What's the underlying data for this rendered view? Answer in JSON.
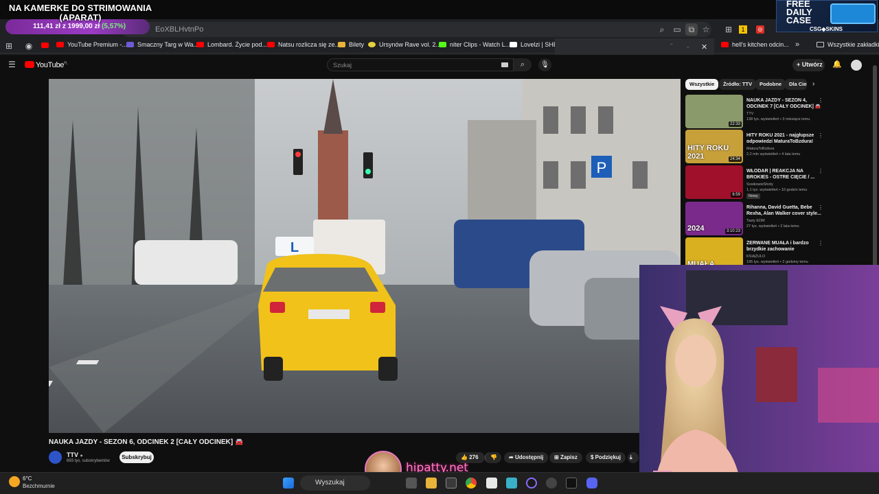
{
  "overlay": {
    "title": "NA KAMERKE DO STRIMOWANIA (APARAT)",
    "goal_text": "111,41 zł z 1999,00 zł",
    "goal_pct": "(5,57%)",
    "goal_fraction": 0.0557
  },
  "promo": {
    "line1": "FREE",
    "line2": "DAILY",
    "line3": "CASE",
    "brand": "CSG◆SKINS"
  },
  "browser": {
    "url": "EoXBLHvtnPo",
    "bookmarks": [
      "YouTube Premium -...",
      "Smaczny Targ w Wa...",
      "Lombard. Życie pod...",
      "Natsu rozlicza się ze...",
      "Bilety",
      "Ursynów Rave vol. 2...",
      "niter Clips - Watch L...",
      "Lovelzi | SHEIN",
      "hell's kitchen odcin...",
      "Wszystkie zakładki"
    ]
  },
  "youtube": {
    "logo": "YouTube",
    "region": "PL",
    "search_placeholder": "Szukaj",
    "create_label": "Utwórz"
  },
  "video": {
    "title": "NAUKA JAZDY - SEZON 6, ODCINEK 2 [CAŁY ODCINEK] 🚘",
    "channel": "TTV",
    "subscribers": "693 tys. subskrybentów",
    "subscribe_label": "Subskrybuj",
    "likes": "276",
    "share_label": "Udostępnij",
    "save_label": "Zapisz",
    "thanks_label": "Podziękuj"
  },
  "chips": [
    "Wszystkie",
    "Źródło: TTV",
    "Podobne",
    "Dla Ciebie"
  ],
  "related": [
    {
      "title": "NAUKA JAZDY - SEZON 4, ODCINEK 7 [CAŁY ODCINEK] 🚘",
      "channel": "TTV",
      "meta": "138 tys. wyświetleń • 3 miesiące temu",
      "duration": "22:33",
      "thumb_color": "#8a9a6a"
    },
    {
      "title": "HITY ROKU 2021 - najgłupsze odpowiedzi MaturaToBzdura!",
      "channel": "MaturaToBzdura",
      "meta": "2,2 mln wyświetleń • 4 lata temu",
      "duration": "24:34",
      "thumb_color": "#c8a03a",
      "thumb_text": "HITY ROKU 2021"
    },
    {
      "title": "WŁODAR | REAKCJA NA BROKIES - OSTRE CIĘCIE / ...",
      "channel": "SosikowieShoty",
      "meta": "1,1 tys. wyświetleń • 10 godzin temu",
      "badge": "Nowy",
      "duration": "6:59",
      "thumb_color": "#a0102a"
    },
    {
      "title": "Rihanna, David Guetta, Bebe Rexha, Alan Walker cover style...",
      "channel": "Tasty EDM",
      "meta": "27 tys. wyświetleń • 2 lata temu",
      "duration": "3:10:23",
      "thumb_color": "#7a2a8a",
      "thumb_text": "2024"
    },
    {
      "title": "ZERWANE MUAŁA i bardzo brzydkie zachowanie",
      "channel": "KSIĄŻULO",
      "meta": "195 tys. wyświetleń • 2 godziny temu",
      "duration": "",
      "thumb_color": "#d8b020",
      "thumb_text": "MUAŁA"
    }
  ],
  "stream": {
    "brand": "hipatty.net"
  },
  "taskbar": {
    "temp": "6°C",
    "weather": "Bezchmurnie",
    "search": "Wyszukaj"
  }
}
